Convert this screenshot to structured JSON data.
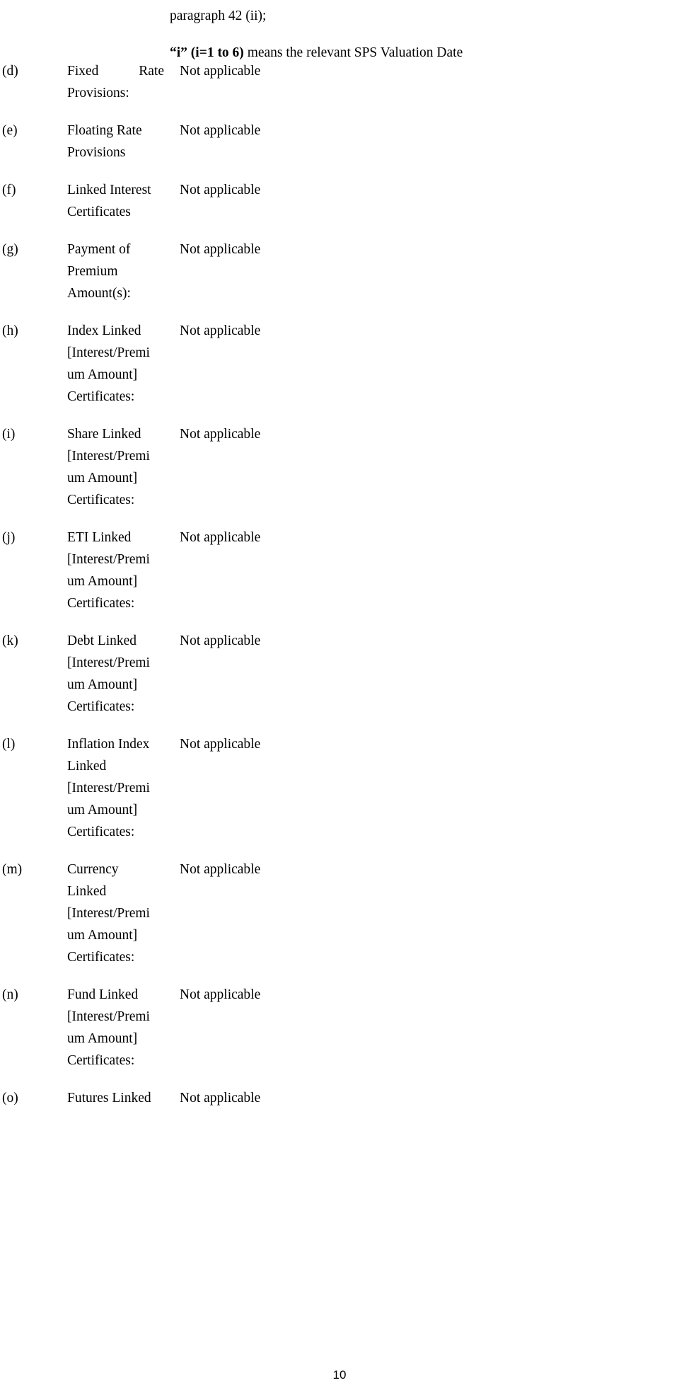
{
  "document": {
    "page_number": "10"
  },
  "header": {
    "lines": [
      {
        "text": "paragraph 42 (ii);",
        "bold_prefix": ""
      },
      {
        "bold_prefix": "“i” (i=1 to 6)",
        "text": " means the relevant SPS Valuation Date"
      }
    ]
  },
  "table": {
    "rows": [
      {
        "marker": "(d)",
        "label_lines": [
          "Fixed|Rate",
          "Provisions:"
        ],
        "justified_first_line": true,
        "value": "Not applicable"
      },
      {
        "marker": "(e)",
        "label_lines": [
          "Floating Rate",
          "Provisions"
        ],
        "justified_first_line": false,
        "value": "Not applicable"
      },
      {
        "marker": "(f)",
        "label_lines": [
          "Linked Interest",
          "Certificates"
        ],
        "justified_first_line": false,
        "value": "Not applicable"
      },
      {
        "marker": "(g)",
        "label_lines": [
          "Payment of",
          "Premium",
          "Amount(s):"
        ],
        "justified_first_line": false,
        "value": "Not applicable"
      },
      {
        "marker": "(h)",
        "label_lines": [
          "Index Linked",
          "[Interest/Premi",
          "um Amount]",
          "Certificates:"
        ],
        "justified_first_line": false,
        "value": "Not applicable"
      },
      {
        "marker": "(i)",
        "label_lines": [
          "Share Linked",
          "[Interest/Premi",
          "um Amount]",
          "Certificates:"
        ],
        "justified_first_line": false,
        "value": "Not applicable"
      },
      {
        "marker": "(j)",
        "label_lines": [
          "ETI Linked",
          "[Interest/Premi",
          "um Amount]",
          "Certificates:"
        ],
        "justified_first_line": false,
        "value": "Not applicable"
      },
      {
        "marker": "(k)",
        "label_lines": [
          "Debt Linked",
          "[Interest/Premi",
          "um Amount]",
          "Certificates:"
        ],
        "justified_first_line": false,
        "value": "Not applicable"
      },
      {
        "marker": "(l)",
        "label_lines": [
          "Inflation Index",
          "Linked",
          "[Interest/Premi",
          "um Amount]",
          "Certificates:"
        ],
        "justified_first_line": false,
        "value": "Not applicable"
      },
      {
        "marker": "(m)",
        "label_lines": [
          "Currency",
          "Linked",
          "[Interest/Premi",
          "um Amount]",
          "Certificates:"
        ],
        "justified_first_line": false,
        "value": "Not applicable"
      },
      {
        "marker": "(n)",
        "label_lines": [
          "Fund Linked",
          "[Interest/Premi",
          "um Amount]",
          "Certificates:"
        ],
        "justified_first_line": false,
        "value": "Not applicable"
      },
      {
        "marker": "(o)",
        "label_lines": [
          "Futures Linked"
        ],
        "justified_first_line": false,
        "value": "Not applicable"
      }
    ]
  }
}
